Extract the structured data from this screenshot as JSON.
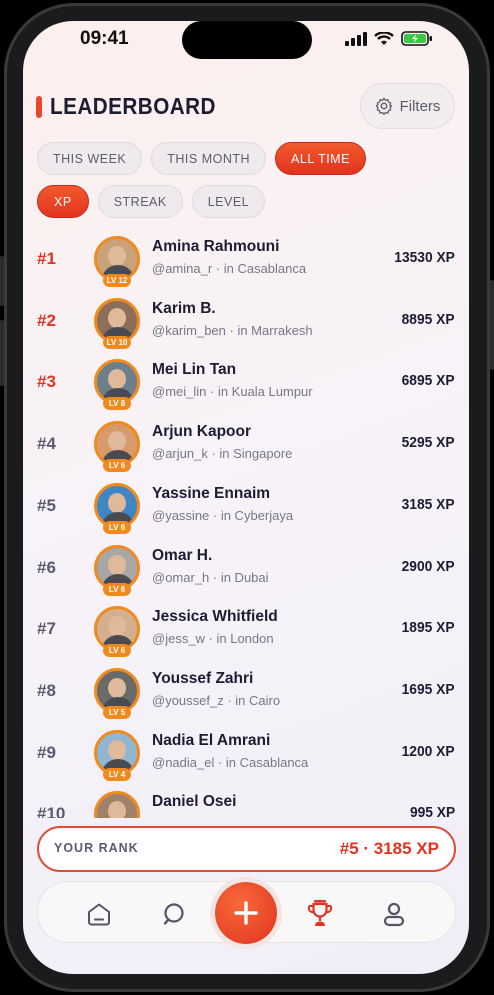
{
  "status_bar": {
    "time": "09:41"
  },
  "header": {
    "title": "LEADERBOARD",
    "filters_label": "Filters"
  },
  "period_tabs": [
    {
      "label": "THIS WEEK",
      "active": false
    },
    {
      "label": "THIS MONTH",
      "active": false
    },
    {
      "label": "ALL TIME",
      "active": true
    }
  ],
  "metric_tabs": [
    {
      "label": "XP",
      "active": true
    },
    {
      "label": "STREAK",
      "active": false
    },
    {
      "label": "LEVEL",
      "active": false
    }
  ],
  "leaderboard": [
    {
      "rank": "#1",
      "name": "Amina Rahmouni",
      "handle": "@amina_r · in Casablanca",
      "level": "LV 12",
      "xp": "13530 XP"
    },
    {
      "rank": "#2",
      "name": "Karim B.",
      "handle": "@karim_ben · in Marrakesh",
      "level": "LV 10",
      "xp": "8895 XP"
    },
    {
      "rank": "#3",
      "name": "Mei Lin Tan",
      "handle": "@mei_lin · in Kuala Lumpur",
      "level": "LV 8",
      "xp": "6895 XP"
    },
    {
      "rank": "#4",
      "name": "Arjun Kapoor",
      "handle": "@arjun_k · in Singapore",
      "level": "LV 6",
      "xp": "5295 XP"
    },
    {
      "rank": "#5",
      "name": "Yassine Ennaim",
      "handle": "@yassine · in Cyberjaya",
      "level": "LV 6",
      "xp": "3185 XP"
    },
    {
      "rank": "#6",
      "name": "Omar H.",
      "handle": "@omar_h · in Dubai",
      "level": "LV 6",
      "xp": "2900 XP"
    },
    {
      "rank": "#7",
      "name": "Jessica Whitfield",
      "handle": "@jess_w · in London",
      "level": "LV 6",
      "xp": "1895 XP"
    },
    {
      "rank": "#8",
      "name": "Youssef Zahri",
      "handle": "@youssef_z · in Cairo",
      "level": "LV 5",
      "xp": "1695 XP"
    },
    {
      "rank": "#9",
      "name": "Nadia El Amrani",
      "handle": "@nadia_el · in Casablanca",
      "level": "LV 4",
      "xp": "1200 XP"
    },
    {
      "rank": "#10",
      "name": "Daniel Osei",
      "handle": "",
      "level": "",
      "xp": "995 XP"
    }
  ],
  "your_rank": {
    "label": "YOUR RANK",
    "value": "#5 · 3185 XP"
  },
  "bottom_nav": {
    "items": [
      "home-icon",
      "search-icon",
      "add-icon",
      "trophy-icon",
      "profile-icon"
    ],
    "active": "trophy-icon"
  },
  "colors": {
    "accent": "#e23320",
    "level_badge": "#f08a1e",
    "text_dark": "#1d1c33"
  }
}
